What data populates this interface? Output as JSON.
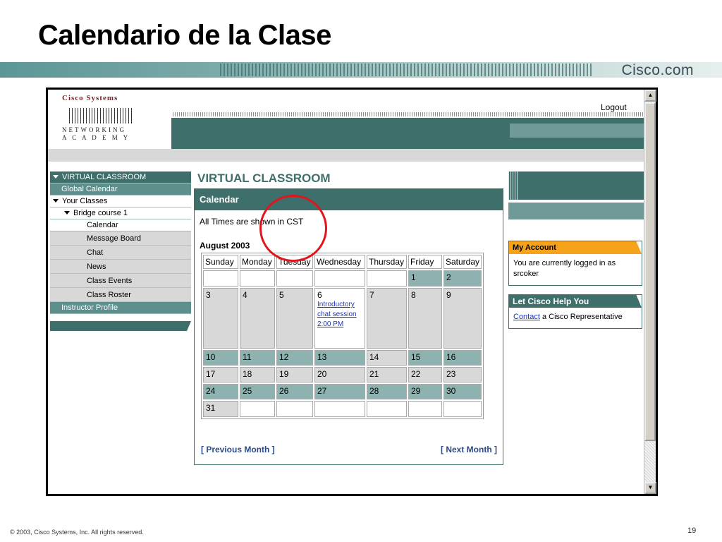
{
  "slide": {
    "title": "Calendario de la Clase",
    "brand": "Cisco.com",
    "copyright": "© 2003, Cisco Systems, Inc. All rights reserved.",
    "page_number": "19"
  },
  "header": {
    "logo_top": "Cisco Systems",
    "logo_line1": "NETWORKING",
    "logo_line2": "A C A D E M Y",
    "logout": "Logout"
  },
  "sidebar": {
    "virtual_classroom": "VIRTUAL CLASSROOM",
    "global_calendar": "Global Calendar",
    "your_classes": "Your Classes",
    "bridge_course": "Bridge course 1",
    "items": [
      "Calendar",
      "Message Board",
      "Chat",
      "News",
      "Class Events",
      "Class Roster"
    ],
    "instructor_profile": "Instructor Profile"
  },
  "main": {
    "section_title": "VIRTUAL CLASSROOM",
    "panel_title": "Calendar",
    "tz_note": "All Times are shown in CST",
    "month": "August 2003",
    "weekdays": [
      "Sunday",
      "Monday",
      "Tuesday",
      "Wednesday",
      "Thursday",
      "Friday",
      "Saturday"
    ],
    "weeks": [
      [
        "",
        "",
        "",
        "",
        "",
        "1",
        "2"
      ],
      [
        "3",
        "4",
        "5",
        "6",
        "7",
        "8",
        "9"
      ],
      [
        "10",
        "11",
        "12",
        "13",
        "14",
        "15",
        "16"
      ],
      [
        "17",
        "18",
        "19",
        "20",
        "21",
        "22",
        "23"
      ],
      [
        "24",
        "25",
        "26",
        "27",
        "28",
        "29",
        "30"
      ],
      [
        "31",
        "",
        "",
        "",
        "",
        "",
        ""
      ]
    ],
    "event": {
      "line1": "Introductory",
      "line2": "chat session",
      "line3": "2:00 PM"
    },
    "prev_month": "[ Previous Month ]",
    "next_month": "[ Next Month ]"
  },
  "right": {
    "my_account_title": "My Account",
    "my_account_text": "You are currently logged in as srcoker",
    "help_title": "Let Cisco Help You",
    "help_link": "Contact",
    "help_text": " a Cisco Representative"
  },
  "colors": {
    "teal_dark": "#3f6f6b",
    "teal_mid": "#5e8f8c",
    "teal_cell": "#8db2b0",
    "orange": "#f7a21b",
    "highlight_red": "#e3141a"
  }
}
